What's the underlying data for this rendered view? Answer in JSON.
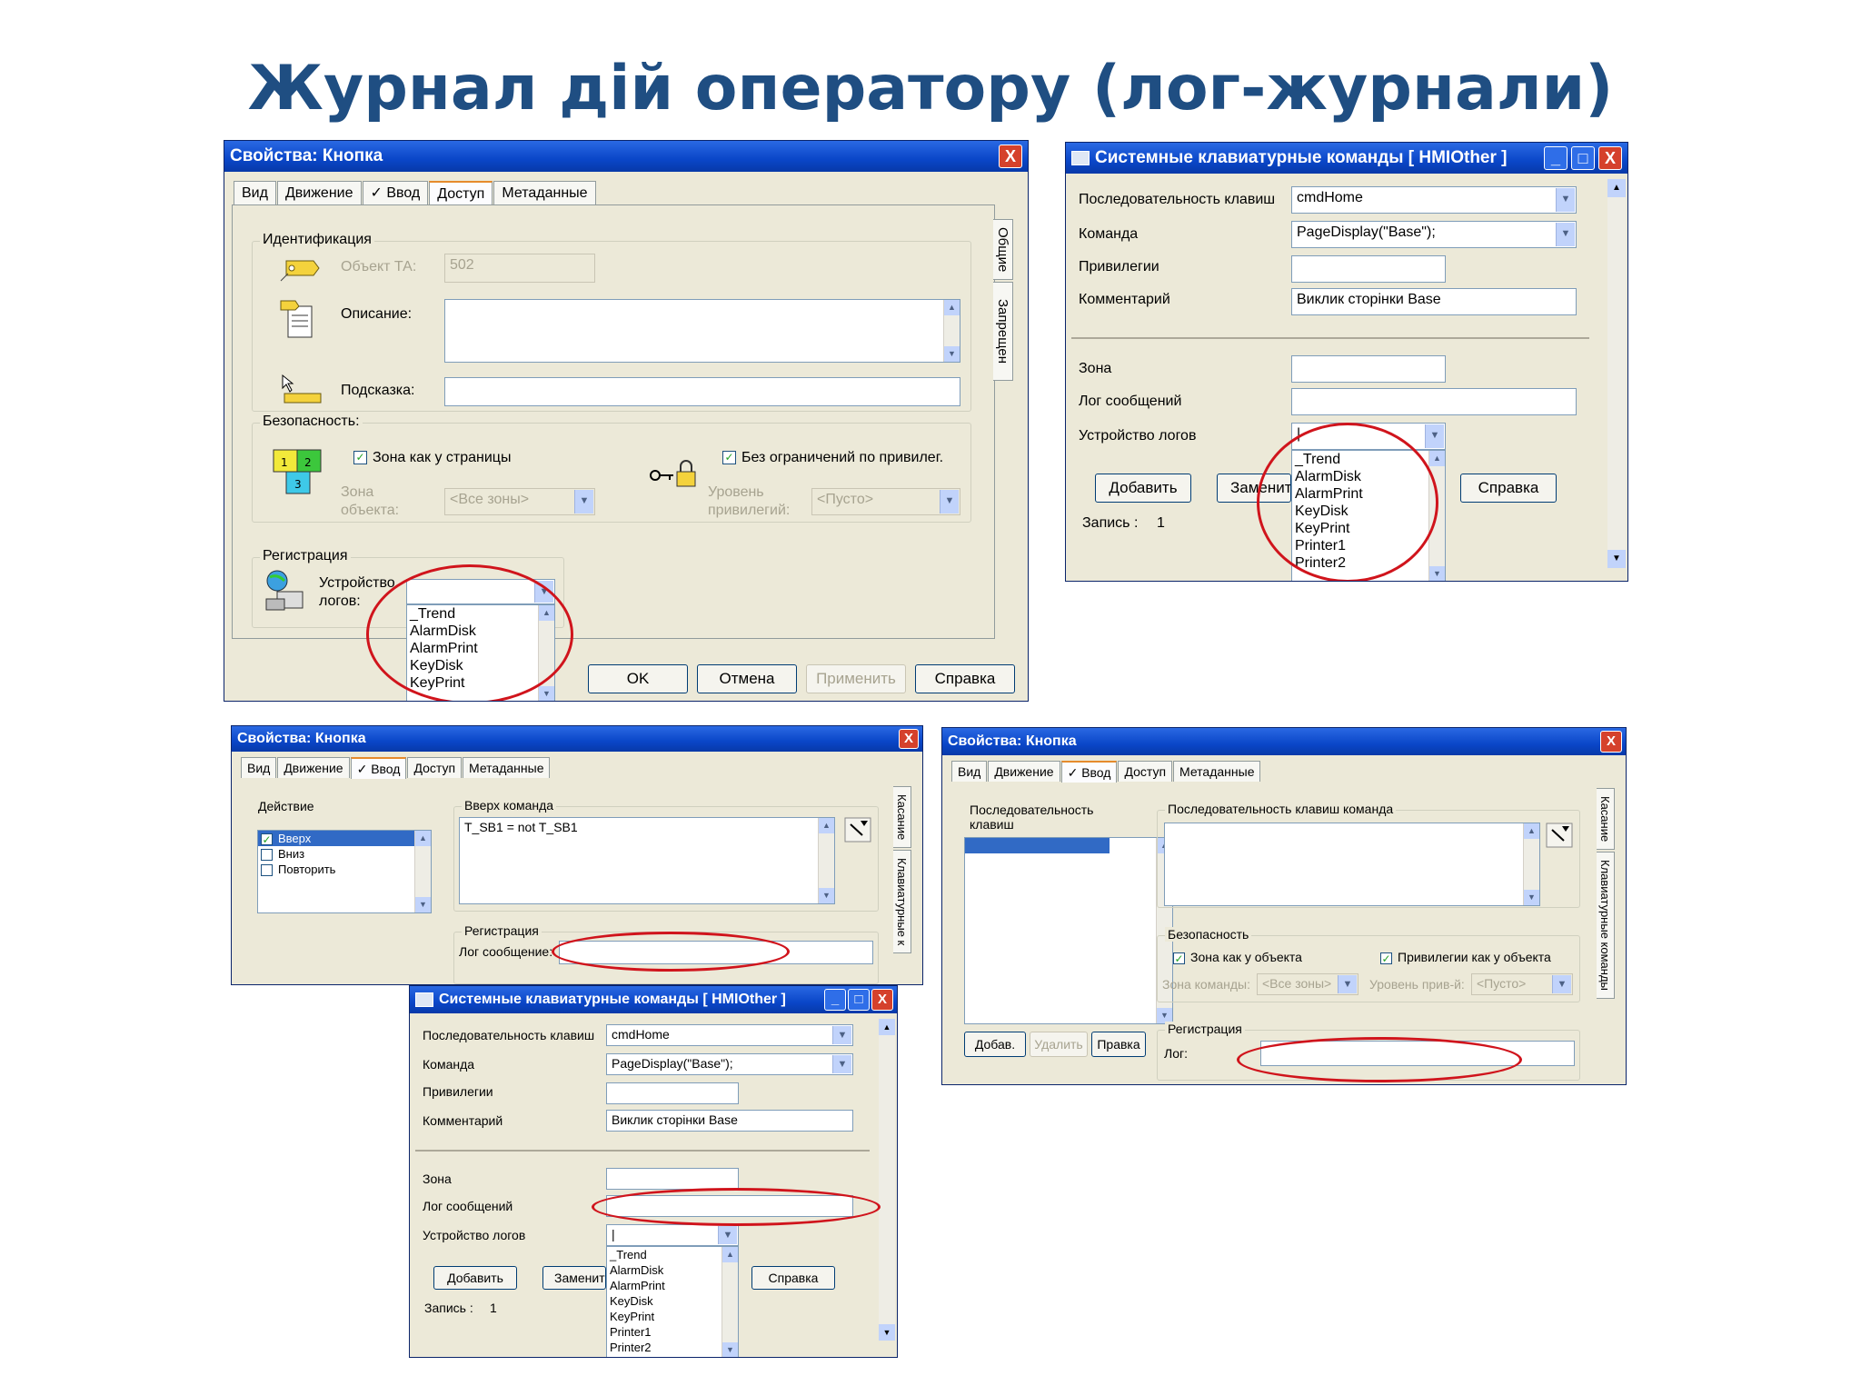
{
  "slide": {
    "title": "Журнал дій оператору (лог-журнали)"
  },
  "close_glyph": "X",
  "minimize_glyph": "_",
  "maximize_glyph": "□",
  "check_glyph": "✓",
  "accent_colors": {
    "title": "#1f4e82",
    "titlebar": "#0a46c8",
    "highlight_oval": "#d0141c",
    "selection": "#316ac5"
  },
  "dlg1": {
    "title": "Свойства: Кнопка",
    "tabs": [
      "Вид",
      "Движение",
      "Ввод",
      "Доступ",
      "Метаданные"
    ],
    "vtabs": [
      "Общие",
      "Запрещен"
    ],
    "ident_group": "Идентификация",
    "object_label": "Объект ТА:",
    "object_value": "502",
    "description_label": "Описание:",
    "hint_label": "Подсказка:",
    "security_group": "Безопасность:",
    "zone_check": "Зона как у страницы",
    "zone_object_label_1": "Зона",
    "zone_object_label_2": "объекта:",
    "zone_value": "<Все зоны>",
    "priv_check": "Без ограничений по привилег.",
    "priv_level_label_1": "Уровень",
    "priv_level_label_2": "привилегий:",
    "priv_value": "<Пусто>",
    "reg_group": "Регистрация",
    "log_device_label_1": "Устройство",
    "log_device_label_2": "логов:",
    "log_device_value": "",
    "dropdown_items": [
      "_Trend",
      "AlarmDisk",
      "AlarmPrint",
      "KeyDisk",
      "KeyPrint"
    ],
    "ok": "OK",
    "cancel": "Отмена",
    "apply": "Применить",
    "help": "Справка"
  },
  "dlg2": {
    "title": "Системные клавиатурные команды [ HMIOther ]",
    "key_seq_label": "Последовательность клавиш",
    "key_seq_value": "cmdHome",
    "command_label": "Команда",
    "command_value": "PageDisplay(\"Base\");",
    "priv_label": "Привилегии",
    "priv_value": "",
    "comment_label": "Комментарий",
    "comment_value": "Виклик сторінки Base",
    "zone_label": "Зона",
    "zone_value": "",
    "log_msg_label": "Лог сообщений",
    "log_msg_value": "",
    "log_device_label": "Устройство логов",
    "log_device_value": "|",
    "dropdown_items": [
      "_Trend",
      "AlarmDisk",
      "AlarmPrint",
      "KeyDisk",
      "KeyPrint",
      "Printer1",
      "Printer2"
    ],
    "add": "Добавить",
    "replace": "Заменить",
    "help": "Справка",
    "record_label": "Запись :",
    "record_value": "1"
  },
  "dlg3": {
    "title": "Свойства: Кнопка",
    "tabs": [
      "Вид",
      "Движение",
      "Ввод",
      "Доступ",
      "Метаданные"
    ],
    "vtabs": [
      "Касание",
      "Клавиатурные к"
    ],
    "action_group": "Действие",
    "actions": [
      "Вверх",
      "Вниз",
      "Повторить"
    ],
    "up_cmd_group": "Вверх команда",
    "up_cmd_value": "T_SB1 = not T_SB1",
    "reg_group": "Регистрация",
    "log_msg_label": "Лог сообщение:"
  },
  "dlg4": {
    "title": "Свойства: Кнопка",
    "tabs": [
      "Вид",
      "Движение",
      "Ввод",
      "Доступ",
      "Метаданные"
    ],
    "vtabs": [
      "Касание",
      "Клавиатурные команды"
    ],
    "keyseq_group": "Последовательность клавиш",
    "keycmd_group": "Последовательность клавиш команда",
    "security_group": "Безопасность",
    "zone_check": "Зона как у объекта",
    "priv_check": "Привилегии как у объекта",
    "zone_cmd_label": "Зона команды:",
    "zone_value": "<Все зоны>",
    "priv_level_label": "Уровень прив-й:",
    "priv_value": "<Пусто>",
    "add": "Добав.",
    "delete": "Удалить",
    "edit": "Правка",
    "reg_group": "Регистрация",
    "log_label": "Лог:"
  },
  "dlg5": {
    "title": "Системные клавиатурные команды [ HMIOther ]",
    "key_seq_label": "Последовательность клавиш",
    "key_seq_value": "cmdHome",
    "command_label": "Команда",
    "command_value": "PageDisplay(\"Base\");",
    "priv_label": "Привилегии",
    "comment_label": "Комментарий",
    "comment_value": "Виклик сторінки Base",
    "zone_label": "Зона",
    "log_msg_label": "Лог сообщений",
    "log_device_label": "Устройство логов",
    "log_device_value": "|",
    "dropdown_items": [
      "_Trend",
      "AlarmDisk",
      "AlarmPrint",
      "KeyDisk",
      "KeyPrint",
      "Printer1",
      "Printer2"
    ],
    "add": "Добавить",
    "replace": "Заменить",
    "help": "Справка",
    "record_label": "Запись :",
    "record_value": "1"
  }
}
